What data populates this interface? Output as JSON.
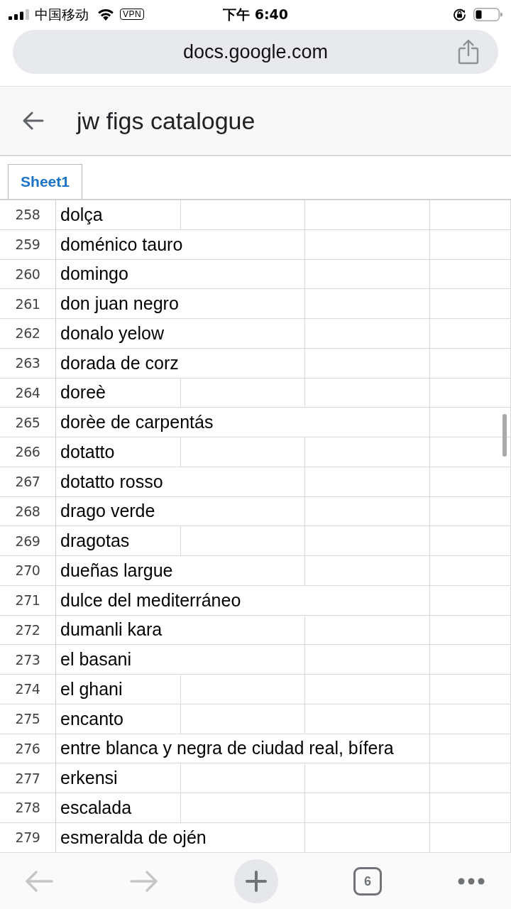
{
  "status_bar": {
    "carrier": "中国移动",
    "vpn": "VPN",
    "time": "下午 6:40"
  },
  "address_bar": {
    "url": "docs.google.com"
  },
  "header": {
    "title": "jw figs catalogue"
  },
  "sheet_tabs": [
    {
      "label": "Sheet1",
      "selected": true
    }
  ],
  "rows": [
    {
      "number": "258",
      "text": "dolça",
      "kind": "single"
    },
    {
      "number": "259",
      "text": "doménico tauro",
      "kind": "double"
    },
    {
      "number": "260",
      "text": "domingo",
      "kind": "double"
    },
    {
      "number": "261",
      "text": "don juan negro",
      "kind": "double"
    },
    {
      "number": "262",
      "text": "donalo yelow",
      "kind": "double"
    },
    {
      "number": "263",
      "text": "dorada de corz",
      "kind": "double"
    },
    {
      "number": "264",
      "text": "doreè",
      "kind": "single"
    },
    {
      "number": "265",
      "text": "dorèe de carpentás",
      "kind": "triple"
    },
    {
      "number": "266",
      "text": "dotatto",
      "kind": "single"
    },
    {
      "number": "267",
      "text": "dotatto rosso",
      "kind": "double"
    },
    {
      "number": "268",
      "text": "drago verde",
      "kind": "double"
    },
    {
      "number": "269",
      "text": "dragotas",
      "kind": "single"
    },
    {
      "number": "270",
      "text": "dueñas largue",
      "kind": "double"
    },
    {
      "number": "271",
      "text": "dulce del mediterráneo",
      "kind": "triple"
    },
    {
      "number": "272",
      "text": "dumanli kara",
      "kind": "double"
    },
    {
      "number": "273",
      "text": "el basani",
      "kind": "double"
    },
    {
      "number": "274",
      "text": "el ghani",
      "kind": "single"
    },
    {
      "number": "275",
      "text": "encanto",
      "kind": "single"
    },
    {
      "number": "276",
      "text": "entre blanca y negra de ciudad real, bífera",
      "kind": "triple"
    },
    {
      "number": "277",
      "text": "erkensi",
      "kind": "single"
    },
    {
      "number": "278",
      "text": "escalada",
      "kind": "single"
    },
    {
      "number": "279",
      "text": "esmeralda de ojén",
      "kind": "double"
    }
  ],
  "toolbar": {
    "back": {
      "disabled": true
    },
    "forward": {
      "disabled": true
    },
    "tab_count": "6"
  }
}
